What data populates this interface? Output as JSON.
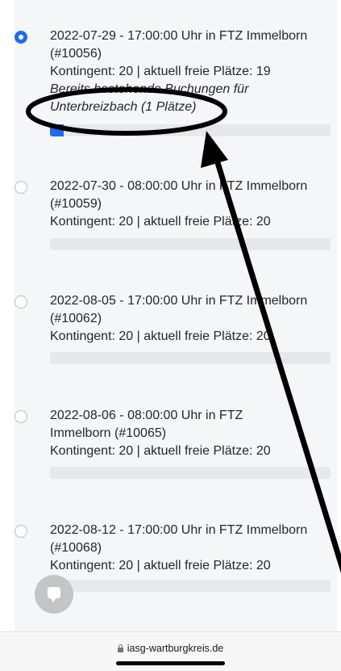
{
  "slots": [
    {
      "selected": true,
      "title_line1": "2022-07-29 - 17:00:00 Uhr in FTZ Immelborn",
      "title_line2": "(#10056)",
      "capacity": "Kontingent: 20 | aktuell freie Plätze: 19",
      "booking_line1": "Bereits bestehende Buchungen für",
      "booking_line2": "Unterbreizbach (1 Plätze)",
      "fill_fraction": 0.05
    },
    {
      "selected": false,
      "title_line1": "2022-07-30 - 08:00:00 Uhr in FTZ Immelborn",
      "title_line2": "(#10059)",
      "capacity": "Kontingent: 20 | aktuell freie Plätze: 20",
      "fill_fraction": 0
    },
    {
      "selected": false,
      "title_line1": "2022-08-05 - 17:00:00 Uhr in FTZ Immelborn",
      "title_line2": "(#10062)",
      "capacity": "Kontingent: 20 | aktuell freie Plätze: 20",
      "fill_fraction": 0
    },
    {
      "selected": false,
      "title_line1": "2022-08-06 - 08:00:00 Uhr in FTZ",
      "title_line2": "Immelborn (#10065)",
      "capacity": "Kontingent: 20 | aktuell freie Plätze: 20",
      "fill_fraction": 0
    },
    {
      "selected": false,
      "title_line1": "2022-08-12 - 17:00:00 Uhr in FTZ Immelborn",
      "title_line2": "(#10068)",
      "capacity": "Kontingent: 20 | aktuell freie Plätze: 20",
      "fill_fraction": 0
    }
  ],
  "browser": {
    "url": "iasg-wartburgkreis.de"
  },
  "chat_button": {
    "icon": "chat-bubble-icon"
  },
  "annotation": {
    "shapes": [
      "ellipse",
      "arrow"
    ],
    "color": "#000000"
  },
  "colors": {
    "accent": "#1e6bf0",
    "background": "#f4f6f8",
    "bar_track": "#e6e8ea",
    "text": "#25282b"
  }
}
